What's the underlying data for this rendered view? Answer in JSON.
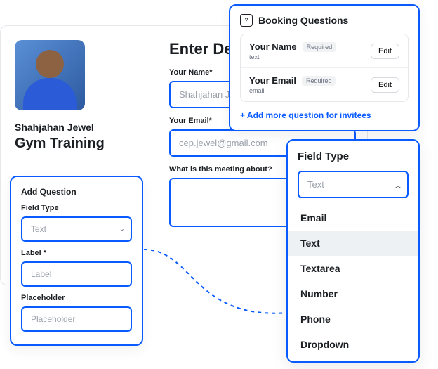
{
  "host": {
    "name": "Shahjahan Jewel",
    "event_title": "Gym Training"
  },
  "form": {
    "heading": "Enter De",
    "name_label": "Your Name*",
    "name_placeholder": "Shahjahan Je",
    "email_label": "Your Email*",
    "email_placeholder": "cep.jewel@gmail.com",
    "about_label": "What is this meeting about?"
  },
  "booking_questions": {
    "title": "Booking Questions",
    "required_badge": "Required",
    "edit_label": "Edit",
    "items": [
      {
        "title": "Your Name",
        "type": "text"
      },
      {
        "title": "Your Email",
        "type": "email"
      }
    ],
    "add_label": "+ Add more question for invitees"
  },
  "add_question": {
    "title": "Add Question",
    "field_type_label": "Field Type",
    "field_type_value": "Text",
    "label_label": "Label *",
    "label_placeholder": "Label",
    "placeholder_label": "Placeholder",
    "placeholder_placeholder": "Placeholder"
  },
  "field_type_dropdown": {
    "title": "Field Type",
    "selected": "Text",
    "options": [
      "Email",
      "Text",
      "Textarea",
      "Number",
      "Phone",
      "Dropdown"
    ],
    "active_index": 1
  }
}
